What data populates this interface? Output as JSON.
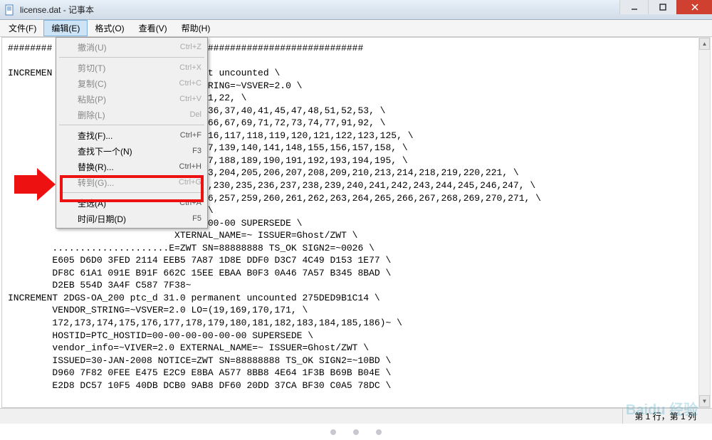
{
  "window": {
    "title": "license.dat - 记事本"
  },
  "menu": {
    "file": "文件(F)",
    "edit": "编辑(E)",
    "format": "格式(O)",
    "view": "查看(V)",
    "help": "帮助(H)"
  },
  "edit_menu": [
    {
      "label": "撤消(U)",
      "shortcut": "Ctrl+Z",
      "disabled": true
    },
    {
      "sep": true
    },
    {
      "label": "剪切(T)",
      "shortcut": "Ctrl+X",
      "disabled": true
    },
    {
      "label": "复制(C)",
      "shortcut": "Ctrl+C",
      "disabled": true
    },
    {
      "label": "粘贴(P)",
      "shortcut": "Ctrl+V",
      "disabled": true
    },
    {
      "label": "删除(L)",
      "shortcut": "Del",
      "disabled": true
    },
    {
      "sep": true
    },
    {
      "label": "查找(F)...",
      "shortcut": "Ctrl+F",
      "disabled": false
    },
    {
      "label": "查找下一个(N)",
      "shortcut": "F3",
      "disabled": false
    },
    {
      "label": "替换(R)...",
      "shortcut": "Ctrl+H",
      "disabled": false
    },
    {
      "label": "转到(G)...",
      "shortcut": "Ctrl+G",
      "disabled": true
    },
    {
      "sep": true
    },
    {
      "label": "全选(A)",
      "shortcut": "Ctrl+A",
      "disabled": false
    },
    {
      "label": "时间/日期(D)",
      "shortcut": "F5",
      "disabled": false
    }
  ],
  "status": {
    "pos": "第 1 行，第 1 列"
  },
  "content_lines": [
    "########                      ##  ##############################",
    "",
    "INCREMEN                      rmanent uncounted \\",
    "                              DOR_STRING=~VSVER=2.0 \\",
    "                              7,19,21,22, \\",
    "                              34,35,36,37,40,41,45,47,48,51,52,53, \\",
    "                              63,65,66,67,69,71,72,73,74,77,91,92, \\",
    "                              ,115,116,117,118,119,120,121,122,123,125, \\",
    "                              135,137,139,140,141,148,155,156,157,158, \\",
    "                              168,187,188,189,190,191,192,193,194,195, \\",
    "                              202,203,204,205,206,207,208,209,210,213,214,218,219,220,221, \\",
    "                              28,229,230,235,236,237,238,239,240,241,242,243,244,245,246,247, \\",
    "                              255,256,257,259,260,261,262,263,264,265,266,267,268,269,270,271, \\",
    "                              278)~ \\",
    "                              00-00-00-00 SUPERSEDE \\",
    "                              XTERNAL_NAME=~ ISSUER=Ghost/ZWT \\",
    "        .....................E=ZWT SN=88888888 TS_OK SIGN2=~0026 \\",
    "        E605 D6D0 3FED 2114 EEB5 7A87 1D8E DDF0 D3C7 4C49 D153 1E77 \\",
    "        DF8C 61A1 091E B91F 662C 15EE EBAA B0F3 0A46 7A57 B345 8BAD \\",
    "        D2EB 554D 3A4F C587 7F38~",
    "INCREMENT 2DGS-OA_200 ptc_d 31.0 permanent uncounted 275DED9B1C14 \\",
    "        VENDOR_STRING=~VSVER=2.0 LO=(19,169,170,171, \\",
    "        172,173,174,175,176,177,178,179,180,181,182,183,184,185,186)~ \\",
    "        HOSTID=PTC_HOSTID=00-00-00-00-00-00 SUPERSEDE \\",
    "        vendor_info=~VIVER=2.0 EXTERNAL_NAME=~ ISSUER=Ghost/ZWT \\",
    "        ISSUED=30-JAN-2008 NOTICE=ZWT SN=88888888 TS_OK SIGN2=~10BD \\",
    "        D960 7F82 0FEE E475 E2C9 E8BA A577 8BB8 4E64 1F3B B69B B04E \\",
    "        E2D8 DC57 10F5 40DB DCB0 9AB8 DF60 20DD 37CA BF30 C0A5 78DC \\"
  ],
  "watermark": "Baidu 经验"
}
